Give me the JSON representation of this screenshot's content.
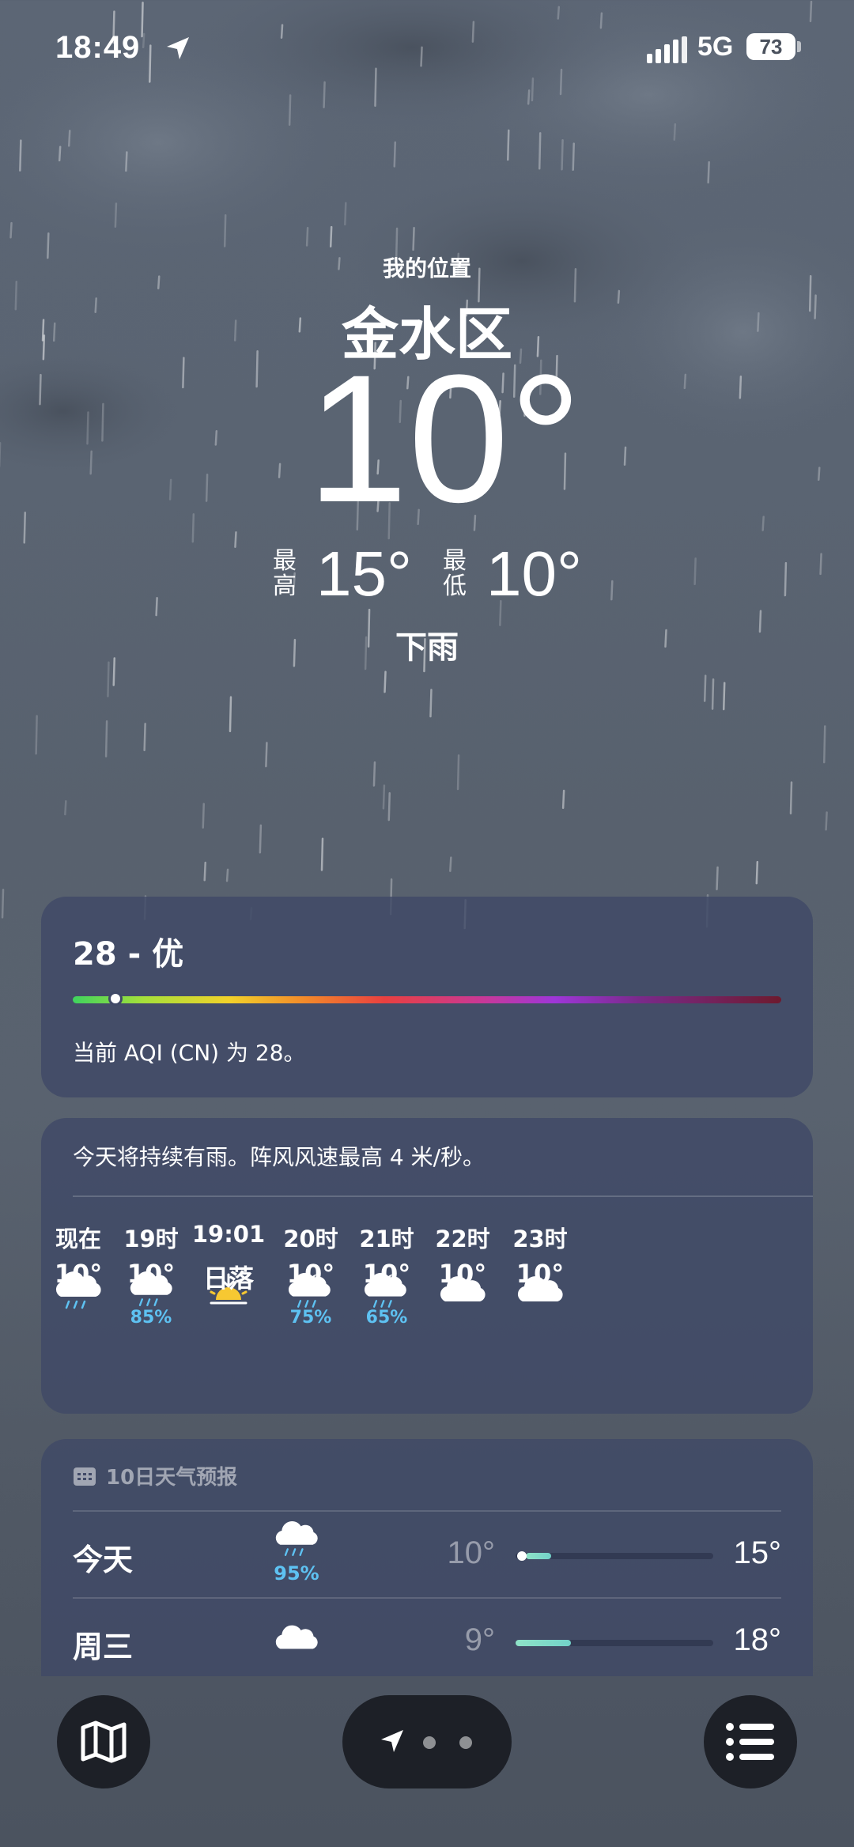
{
  "status": {
    "time": "18:49",
    "network": "5G",
    "battery": "73"
  },
  "header": {
    "my_location": "我的位置",
    "city": "金水区",
    "temperature": "10°",
    "high_label": "最高",
    "high": "15°",
    "low_label": "最低",
    "low": "10°",
    "condition": "下雨"
  },
  "aqi": {
    "title": "28 - 优",
    "description": "当前 AQI (CN) 为 28。",
    "level_fraction": 0.06
  },
  "hourly": {
    "summary": "今天将持续有雨。阵风风速最高 4 米/秒。",
    "items": [
      {
        "label": "现在",
        "icon": "cloud-rain-icon",
        "pct": "",
        "temp": "10°"
      },
      {
        "label": "19时",
        "icon": "cloud-rain-icon",
        "pct": "85%",
        "temp": "10°"
      },
      {
        "label": "19:01",
        "icon": "sunset-icon",
        "pct": "",
        "temp": "日落"
      },
      {
        "label": "20时",
        "icon": "moon-cloud-rain-icon",
        "pct": "75%",
        "temp": "10°"
      },
      {
        "label": "21时",
        "icon": "moon-cloud-rain-icon",
        "pct": "65%",
        "temp": "10°"
      },
      {
        "label": "22时",
        "icon": "cloud-icon",
        "pct": "",
        "temp": "10°"
      },
      {
        "label": "23时",
        "icon": "cloud-icon",
        "pct": "",
        "temp": "10°"
      }
    ]
  },
  "daily": {
    "heading": "10日天气预报",
    "days": [
      {
        "name": "今天",
        "icon": "cloud-rain-icon",
        "pct": "95%",
        "low": "10°",
        "high": "15°",
        "range_start": 0.05,
        "range_end": 0.18,
        "current": 0.03
      },
      {
        "name": "周三",
        "icon": "cloud-icon",
        "pct": "",
        "low": "9°",
        "high": "18°",
        "range_start": 0.0,
        "range_end": 0.28,
        "current": null
      }
    ]
  },
  "colors": {
    "card": "#404967",
    "precip": "#5ec2f2",
    "button": "#1d2027"
  }
}
